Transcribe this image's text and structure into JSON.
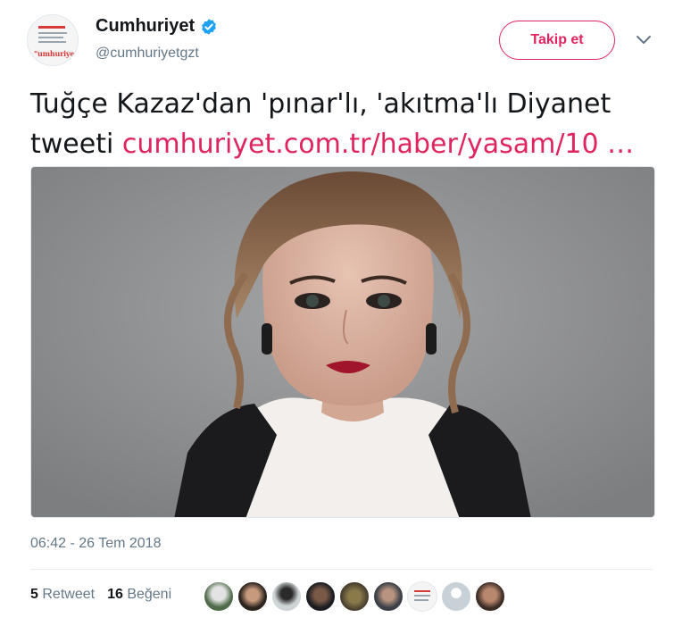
{
  "account": {
    "name": "Cumhuriyet",
    "handle": "@cumhuriyetgzt",
    "logo_text": "\"umhuriye\"",
    "verified": true
  },
  "follow_button": {
    "label": "Takip et"
  },
  "tweet": {
    "text_line1": "Tuğçe Kazaz'dan 'pınar'lı, 'akıtma'lı Diyanet",
    "text_line2_prefix": "tweeti ",
    "link": "cumhuriyet.com.tr/haber/yasam/10",
    "link_ellipsis": " …",
    "timestamp": "06:42 - 26 Tem 2018"
  },
  "stats": {
    "retweet_count": "5",
    "retweet_label": "Retweet",
    "like_count": "16",
    "like_label": "Beğeni"
  },
  "likers": [
    {
      "icon": "user-avatar-1"
    },
    {
      "icon": "user-avatar-2"
    },
    {
      "icon": "user-avatar-3"
    },
    {
      "icon": "user-avatar-4"
    },
    {
      "icon": "user-avatar-5"
    },
    {
      "icon": "user-avatar-6"
    },
    {
      "icon": "user-avatar-7"
    },
    {
      "icon": "user-avatar-8"
    },
    {
      "icon": "user-avatar-9"
    }
  ],
  "colors": {
    "accent": "#e0245e",
    "muted": "#657786",
    "verified_blue": "#1da1f2"
  }
}
